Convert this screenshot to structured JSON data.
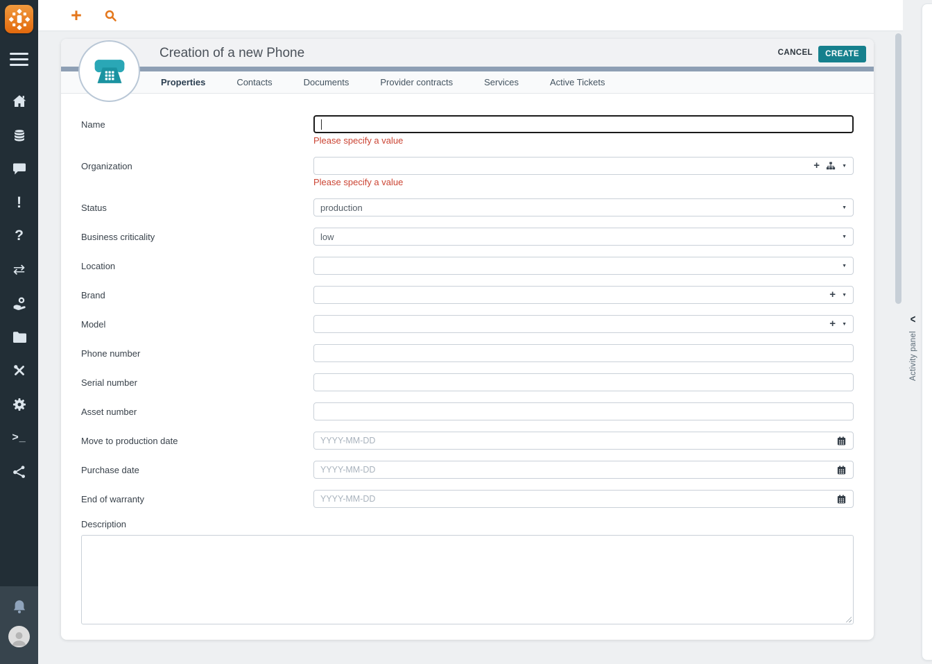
{
  "topbar": {
    "new_label": "+",
    "search_icon": "search-icon"
  },
  "header": {
    "title": "Creation of a new Phone",
    "cancel_label": "CANCEL",
    "create_label": "CREATE",
    "object_icon": "phone-icon"
  },
  "tabs": [
    {
      "id": "properties",
      "label": "Properties",
      "active": true
    },
    {
      "id": "contacts",
      "label": "Contacts",
      "active": false
    },
    {
      "id": "documents",
      "label": "Documents",
      "active": false
    },
    {
      "id": "provider-contracts",
      "label": "Provider contracts",
      "active": false
    },
    {
      "id": "services",
      "label": "Services",
      "active": false
    },
    {
      "id": "active-tickets",
      "label": "Active Tickets",
      "active": false
    }
  ],
  "form": {
    "fields": [
      {
        "id": "name",
        "label": "Name",
        "type": "text",
        "value": "",
        "focused": true,
        "error": "Please specify a value"
      },
      {
        "id": "organization",
        "label": "Organization",
        "type": "lookup",
        "value": "",
        "icons": [
          "plus-icon",
          "sitemap-icon",
          "caret-down-icon"
        ],
        "error": "Please specify a value"
      },
      {
        "id": "status",
        "label": "Status",
        "type": "select",
        "value": "production"
      },
      {
        "id": "business-criticality",
        "label": "Business criticality",
        "type": "select",
        "value": "low"
      },
      {
        "id": "location",
        "label": "Location",
        "type": "select",
        "value": ""
      },
      {
        "id": "brand",
        "label": "Brand",
        "type": "lookup",
        "value": "",
        "icons": [
          "plus-icon",
          "caret-down-icon"
        ]
      },
      {
        "id": "model",
        "label": "Model",
        "type": "lookup",
        "value": "",
        "icons": [
          "plus-icon",
          "caret-down-icon"
        ]
      },
      {
        "id": "phone-number",
        "label": "Phone number",
        "type": "text",
        "value": ""
      },
      {
        "id": "serial-number",
        "label": "Serial number",
        "type": "text",
        "value": ""
      },
      {
        "id": "asset-number",
        "label": "Asset number",
        "type": "text",
        "value": ""
      },
      {
        "id": "move-to-production-date",
        "label": "Move to production date",
        "type": "date",
        "value": "",
        "placeholder": "YYYY-MM-DD",
        "icons": [
          "calendar-icon"
        ]
      },
      {
        "id": "purchase-date",
        "label": "Purchase date",
        "type": "date",
        "value": "",
        "placeholder": "YYYY-MM-DD",
        "icons": [
          "calendar-icon"
        ]
      },
      {
        "id": "end-of-warranty",
        "label": "End of warranty",
        "type": "date",
        "value": "",
        "placeholder": "YYYY-MM-DD",
        "icons": [
          "calendar-icon"
        ]
      },
      {
        "id": "description",
        "label": "Description",
        "type": "textarea",
        "value": ""
      }
    ]
  },
  "sidebar": {
    "logo_icon": "itop-logo",
    "menu_icon": "hamburger-icon",
    "items": [
      {
        "name": "home"
      },
      {
        "name": "data"
      },
      {
        "name": "chat"
      },
      {
        "name": "alerts"
      },
      {
        "name": "help"
      },
      {
        "name": "transfer"
      },
      {
        "name": "services"
      },
      {
        "name": "documents"
      },
      {
        "name": "tools"
      },
      {
        "name": "settings"
      },
      {
        "name": "console"
      },
      {
        "name": "share"
      }
    ],
    "bottom": [
      {
        "name": "notifications"
      },
      {
        "name": "user"
      }
    ]
  },
  "activity_panel": {
    "collapse_icon": "<",
    "label": "Activity panel"
  },
  "colors": {
    "accent_teal": "#16808d",
    "accent_orange": "#e4771c",
    "error_red": "#cb4433",
    "sidebar_bg": "#222e36",
    "tab_bar": "#8e9fb4"
  }
}
